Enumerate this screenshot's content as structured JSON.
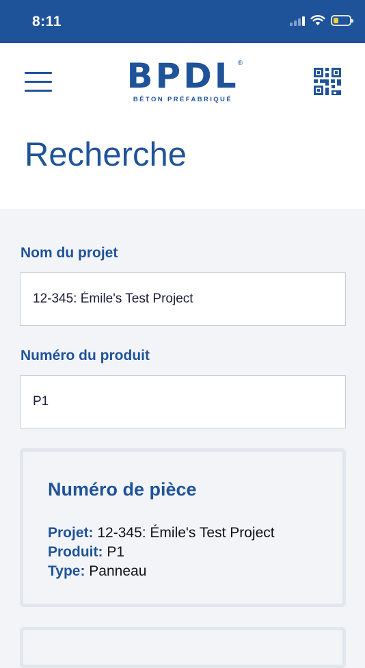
{
  "status_bar": {
    "time": "8:11",
    "battery_level": 0.3,
    "battery_color": "#f5d33d"
  },
  "header": {
    "logo_main": "BPDL",
    "logo_reg": "®",
    "logo_sub": "BÉTON PRÉFABRIQUÉ",
    "menu_icon": "hamburger-menu-icon",
    "qr_icon": "qr-code-icon"
  },
  "page": {
    "title": "Recherche"
  },
  "form": {
    "project": {
      "label": "Nom du projet",
      "value": "12-345: Émile's Test Project"
    },
    "product": {
      "label": "Numéro du produit",
      "value": "P1"
    }
  },
  "results": [
    {
      "title": "Numéro de pièce",
      "project_label": "Projet:",
      "project_value": "12-345: Émile's Test Project",
      "product_label": "Produit:",
      "product_value": "P1",
      "type_label": "Type:",
      "type_value": "Panneau"
    }
  ],
  "colors": {
    "brand": "#1f5399",
    "background": "#f2f4f8",
    "card_border": "#e2e6ed"
  }
}
